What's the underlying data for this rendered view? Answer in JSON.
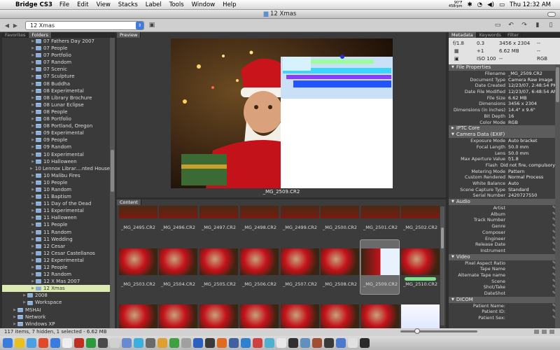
{
  "menubar": {
    "app_name": "Bridge CS3",
    "items": [
      "File",
      "Edit",
      "View",
      "Stacks",
      "Label",
      "Tools",
      "Window",
      "Help"
    ],
    "temp": "90°F",
    "info": "458rpm",
    "clock": "Thu 12:32 AM"
  },
  "window": {
    "title": "12 Xmas"
  },
  "toolbar": {
    "path_value": "12 Xmas"
  },
  "left_panel": {
    "tabs": [
      "Favorites",
      "Folders"
    ],
    "folders": [
      {
        "label": "07 Fathers Day 2007"
      },
      {
        "label": "07 People"
      },
      {
        "label": "07 Portfolio"
      },
      {
        "label": "07 Random"
      },
      {
        "label": "07 Scenic"
      },
      {
        "label": "07 Sculpture"
      },
      {
        "label": "08 Buddha"
      },
      {
        "label": "08 Experimental"
      },
      {
        "label": "08 Library Brochure"
      },
      {
        "label": "08 Lunar Eclipse"
      },
      {
        "label": "08 People"
      },
      {
        "label": "08 Portfolio"
      },
      {
        "label": "08 Portland, Oregon"
      },
      {
        "label": "09 Experimental"
      },
      {
        "label": "09 People"
      },
      {
        "label": "09 Random"
      },
      {
        "label": "10 Experimental"
      },
      {
        "label": "10 Halloween"
      },
      {
        "label": "10 Lennox Librar....nted House 2007"
      },
      {
        "label": "10 Malibu Fires"
      },
      {
        "label": "10 People"
      },
      {
        "label": "10 Random"
      },
      {
        "label": "11 Baptism"
      },
      {
        "label": "11 Day of the Dead"
      },
      {
        "label": "11 Experimental"
      },
      {
        "label": "11 Halloween"
      },
      {
        "label": "11 People"
      },
      {
        "label": "11 Random"
      },
      {
        "label": "11 Wedding"
      },
      {
        "label": "12 Cesar"
      },
      {
        "label": "12 Cesar Castellanos"
      },
      {
        "label": "12 Experimental"
      },
      {
        "label": "12 People"
      },
      {
        "label": "12 Random"
      },
      {
        "label": "12 X Mas 2007"
      },
      {
        "label": "12 Xmas"
      },
      {
        "label": "2008"
      },
      {
        "label": "Workspace"
      },
      {
        "label": "MSHAI"
      },
      {
        "label": "Network"
      },
      {
        "label": "Windows XP"
      }
    ]
  },
  "preview": {
    "tab": "Preview",
    "caption": "_MG_2509.CR2"
  },
  "content": {
    "tab": "Content",
    "row1": [
      "_MG_2495.CR2",
      "_MG_2496.CR2",
      "_MG_2497.CR2",
      "_MG_2498.CR2",
      "_MG_2499.CR2",
      "_MG_2500.CR2",
      "_MG_2501.CR2",
      "_MG_2502.CR2"
    ],
    "row2": [
      "_MG_2503.CR2",
      "_MG_2504.CR2",
      "_MG_2505.CR2",
      "_MG_2506.CR2",
      "_MG_2507.CR2",
      "_MG_2508.CR2",
      "_MG_2509.CR2",
      "_MG_2510.CR2"
    ]
  },
  "metadata": {
    "tabs": [
      "Metadata",
      "Keywords",
      "Filter"
    ],
    "summary": {
      "aperture": "f/1.8",
      "shutter": "0.3",
      "ev": "+1",
      "iso": "ISO 100",
      "dims": "3456 x 2304",
      "size": "6.62 MB",
      "mode": "RGB",
      "dash1": "--",
      "dash2": "--",
      "dash3": "--"
    },
    "sections": [
      {
        "title": "File Properties",
        "rows": [
          {
            "k": "Filename",
            "v": "_MG_2509.CR2"
          },
          {
            "k": "Document Type",
            "v": "Camera Raw image"
          },
          {
            "k": "Date Created",
            "v": "12/23/07, 2:48:54 PM"
          },
          {
            "k": "Date File Modified",
            "v": "12/23/07, 6:48:54 AM"
          },
          {
            "k": "File Size",
            "v": "6.62 MB"
          },
          {
            "k": "Dimensions",
            "v": "3456 x 2304"
          },
          {
            "k": "Dimensions (in inches)",
            "v": "14.4\" x 9.6\""
          },
          {
            "k": "Bit Depth",
            "v": "16"
          },
          {
            "k": "Color Mode",
            "v": "RGB"
          }
        ]
      },
      {
        "title": "IPTC Core",
        "rows": []
      },
      {
        "title": "Camera Data (EXIF)",
        "rows": [
          {
            "k": "Exposure Mode",
            "v": "Auto bracket"
          },
          {
            "k": "Focal Length",
            "v": "50.0 mm"
          },
          {
            "k": "Lens",
            "v": "50.0 mm"
          },
          {
            "k": "Max Aperture Value",
            "v": "f/1.8"
          },
          {
            "k": "Flash",
            "v": "Did not fire, compulsory mode"
          },
          {
            "k": "Metering Mode",
            "v": "Pattern"
          },
          {
            "k": "Custom Rendered",
            "v": "Normal Process"
          },
          {
            "k": "White Balance",
            "v": "Auto"
          },
          {
            "k": "Scene Capture Type",
            "v": "Standard"
          },
          {
            "k": "Serial Number",
            "v": "2420727550"
          }
        ]
      },
      {
        "title": "Audio",
        "rows": [
          {
            "k": "Artist",
            "v": ""
          },
          {
            "k": "Album",
            "v": ""
          },
          {
            "k": "Track Number",
            "v": ""
          },
          {
            "k": "Genre",
            "v": ""
          },
          {
            "k": "Composer",
            "v": ""
          },
          {
            "k": "Engineer",
            "v": ""
          },
          {
            "k": "Release Date",
            "v": ""
          },
          {
            "k": "Instrument",
            "v": ""
          }
        ]
      },
      {
        "title": "Video",
        "rows": [
          {
            "k": "Pixel Aspect Ratio",
            "v": ""
          },
          {
            "k": "Tape Name",
            "v": ""
          },
          {
            "k": "Alternate Tape name",
            "v": ""
          },
          {
            "k": "Scene",
            "v": ""
          },
          {
            "k": "Shot/Take",
            "v": ""
          },
          {
            "k": "DateShot",
            "v": ""
          }
        ]
      },
      {
        "title": "DICOM",
        "rows": [
          {
            "k": "Patient Name:",
            "v": ""
          },
          {
            "k": "Patient ID:",
            "v": ""
          },
          {
            "k": "Patient Sex:",
            "v": ""
          }
        ]
      }
    ]
  },
  "status": {
    "text": "117 items, 7 hidden, 1 selected - 6.62 MB"
  }
}
